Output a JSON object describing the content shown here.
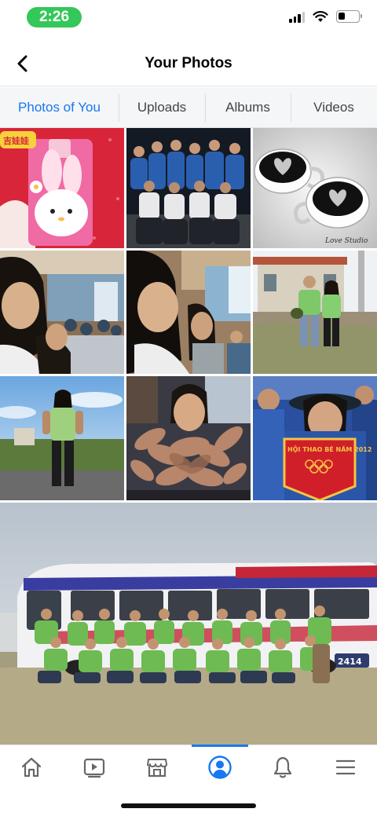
{
  "status_bar": {
    "time": "2:26",
    "time_pill_color": "#34c759",
    "icons": [
      "signal-icon",
      "wifi-icon",
      "battery-icon"
    ]
  },
  "header": {
    "title": "Your Photos",
    "back_icon": "chevron-left-icon"
  },
  "tabs": [
    {
      "label": "Photos of You",
      "active": true
    },
    {
      "label": "Uploads",
      "active": false
    },
    {
      "label": "Albums",
      "active": false
    },
    {
      "label": "Videos",
      "active": false
    }
  ],
  "photos": [
    {
      "name": "photo-pink-bunny-case",
      "caption": "吉娃娃"
    },
    {
      "name": "photo-group-blue-shirts"
    },
    {
      "name": "photo-heart-coffee-cups",
      "caption": "Love Studio"
    },
    {
      "name": "photo-girl-classroom-1"
    },
    {
      "name": "photo-girl-classroom-2"
    },
    {
      "name": "photo-couple-green-shirts"
    },
    {
      "name": "photo-girl-green-shirt-road"
    },
    {
      "name": "photo-girl-dried-leaves"
    },
    {
      "name": "photo-girl-red-banner",
      "caption": "HỘI THAO BÉ NĂM 2012"
    },
    {
      "name": "photo-group-bus",
      "caption": "2414"
    }
  ],
  "bottom_nav": [
    {
      "name": "home-icon",
      "active": false
    },
    {
      "name": "watch-video-icon",
      "active": false
    },
    {
      "name": "marketplace-icon",
      "active": false
    },
    {
      "name": "profile-icon",
      "active": true
    },
    {
      "name": "notifications-bell-icon",
      "active": false
    },
    {
      "name": "menu-icon",
      "active": false
    }
  ],
  "colors": {
    "accent": "#1877f2",
    "tab_background": "#f5f6f7",
    "divider": "#e4e6eb"
  }
}
